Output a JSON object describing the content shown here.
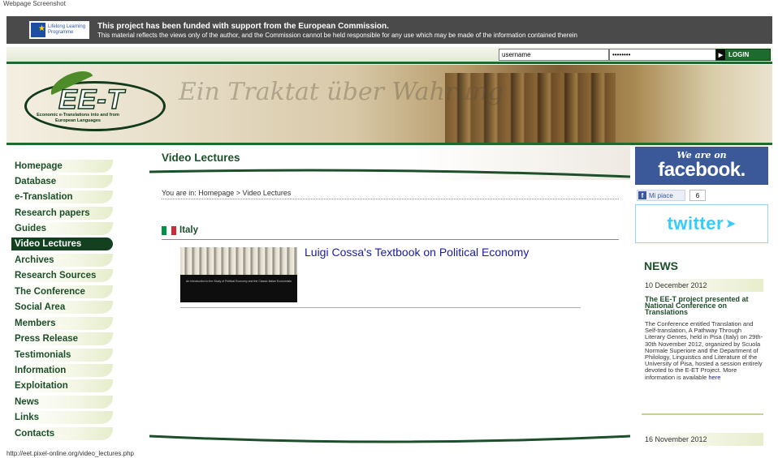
{
  "caption": "Webpage Screenshot",
  "status_url": "http://eet.pixel-online.org/video_lectures.php",
  "eu_banner": {
    "programme": "Lifelong Learning Programme",
    "line1": "This project has been funded with support from the European Commission.",
    "line2": "This material reflects the views only of the author, and the Commission cannot be held responsible for any use which may be made of the information contained therein"
  },
  "login": {
    "username_value": "username",
    "password_value": "••••••••",
    "button_label": "LOGIN"
  },
  "header": {
    "logo_text": "EE-T",
    "logo_subtitle": "Economic e-Translations into and from European Languages",
    "background_script": "Ein Traktat über Wahrung"
  },
  "sidebar": {
    "items": [
      {
        "label": "Homepage"
      },
      {
        "label": "Database"
      },
      {
        "label": "e-Translation"
      },
      {
        "label": "Research papers"
      },
      {
        "label": "Guides"
      },
      {
        "label": "Video Lectures",
        "active": true
      },
      {
        "label": "Archives"
      },
      {
        "label": "Research Sources"
      },
      {
        "label": "The Conference"
      },
      {
        "label": "Social Area"
      },
      {
        "label": "Members"
      },
      {
        "label": "Press Release"
      },
      {
        "label": "Testimonials"
      },
      {
        "label": "Information"
      },
      {
        "label": "Exploitation"
      },
      {
        "label": "News"
      },
      {
        "label": "Links"
      },
      {
        "label": "Contacts"
      }
    ]
  },
  "main": {
    "title": "Video Lectures",
    "breadcrumb": "You are in: Homepage > Video Lectures",
    "section_title": "Italy",
    "lecture": {
      "title": "Luigi Cossa's Textbook on Political Economy",
      "thumb_caption": "An Introduction to the Study of Political Economy and the Classic Italian Economists"
    }
  },
  "right": {
    "facebook_tagline": "We are on",
    "facebook_logo": "facebook.",
    "like_label": "Mi piace",
    "like_count": "6",
    "twitter_logo": "twitter",
    "news_title": "NEWS",
    "news": [
      {
        "date": "10 December 2012",
        "headline": "The EE-T project presented at National Conference on Translations",
        "body": "The Conference entitled Translation and Self-translation, A Pathway Through Literary Genres, held in Pisa (Italy) on 29th-30th November 2012, organized by Scuola Normale Superiore and the Department of Philology, Linguistics and Literature of the University of Pisa, hosted a session entirely devoted to the E-ET Project. More information is available",
        "link_label": "here"
      },
      {
        "date": "16 November 2012"
      }
    ]
  },
  "colors": {
    "accent_green": "#1c4f2a",
    "eu_bar": "#4a4a4a",
    "facebook_blue": "#3b5998",
    "twitter_blue": "#33ccff",
    "italy_green": "#009246",
    "italy_white": "#ffffff",
    "italy_red": "#ce2b37"
  }
}
